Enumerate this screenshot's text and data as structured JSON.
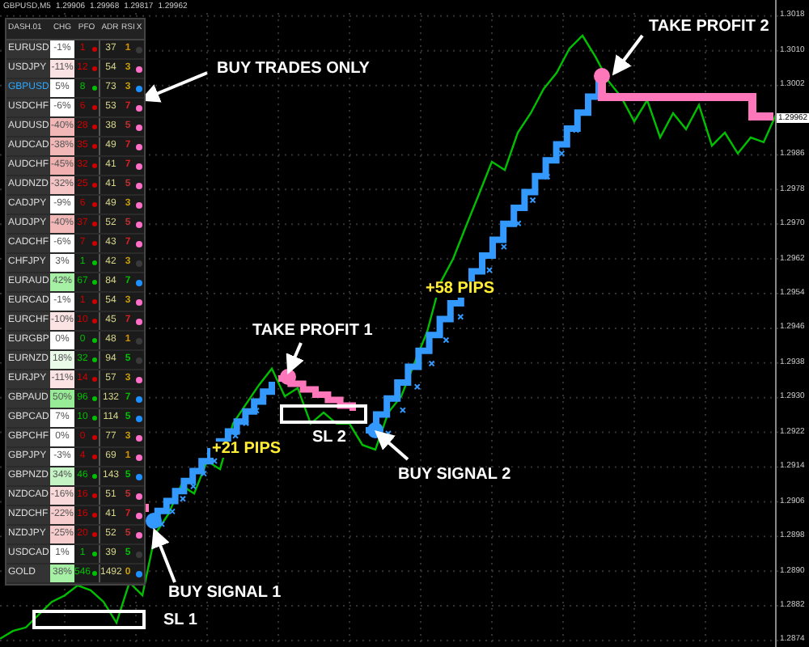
{
  "header": {
    "prices": [
      "1.29906",
      "1.29968",
      "1.29817",
      "1.29962"
    ]
  },
  "dashboard": {
    "columns": [
      "DASH.01",
      "CHG",
      "PFO",
      "ADR",
      "RSI",
      "X"
    ],
    "rows": [
      {
        "pair": "EURUSD",
        "selected": false,
        "chg": {
          "text": "-1%",
          "color": "#ffffff"
        },
        "pfo": {
          "text": "1",
          "color": "#d00000"
        },
        "adr": "37",
        "rsi": {
          "text": "1",
          "color": "#d09000"
        },
        "signal": {
          "color": "#3a3a3a"
        }
      },
      {
        "pair": "USDJPY",
        "selected": false,
        "chg": {
          "text": "-11%",
          "color": "#fbe3e3"
        },
        "pfo": {
          "text": "12",
          "color": "#d00000"
        },
        "adr": "54",
        "rsi": {
          "text": "3",
          "color": "#c8a000"
        },
        "signal": {
          "color": "#ff6ec7"
        }
      },
      {
        "pair": "GBPUSD",
        "selected": true,
        "chg": {
          "text": "5%",
          "color": "#ffffff"
        },
        "pfo": {
          "text": "8",
          "color": "#00c000"
        },
        "adr": "73",
        "rsi": {
          "text": "3",
          "color": "#c8a000"
        },
        "signal": {
          "color": "#1e90ff"
        }
      },
      {
        "pair": "USDCHF",
        "selected": false,
        "chg": {
          "text": "-6%",
          "color": "#ffffff"
        },
        "pfo": {
          "text": "6",
          "color": "#d00000"
        },
        "adr": "53",
        "rsi": {
          "text": "7",
          "color": "#e02020"
        },
        "signal": {
          "color": "#ff6ec7"
        }
      },
      {
        "pair": "AUDUSD",
        "selected": false,
        "chg": {
          "text": "-40%",
          "color": "#f2b8b8"
        },
        "pfo": {
          "text": "28",
          "color": "#d00000"
        },
        "adr": "38",
        "rsi": {
          "text": "5",
          "color": "#c03030"
        },
        "signal": {
          "color": "#ff6ec7"
        }
      },
      {
        "pair": "AUDCAD",
        "selected": false,
        "chg": {
          "text": "-38%",
          "color": "#f2b8b8"
        },
        "pfo": {
          "text": "35",
          "color": "#d00000"
        },
        "adr": "49",
        "rsi": {
          "text": "7",
          "color": "#e02020"
        },
        "signal": {
          "color": "#ff6ec7"
        }
      },
      {
        "pair": "AUDCHF",
        "selected": false,
        "chg": {
          "text": "-45%",
          "color": "#f0b0b0"
        },
        "pfo": {
          "text": "32",
          "color": "#d00000"
        },
        "adr": "41",
        "rsi": {
          "text": "7",
          "color": "#e02020"
        },
        "signal": {
          "color": "#ff6ec7"
        }
      },
      {
        "pair": "AUDNZD",
        "selected": false,
        "chg": {
          "text": "-32%",
          "color": "#f4c4c4"
        },
        "pfo": {
          "text": "25",
          "color": "#d00000"
        },
        "adr": "41",
        "rsi": {
          "text": "5",
          "color": "#c03030"
        },
        "signal": {
          "color": "#ff6ec7"
        }
      },
      {
        "pair": "CADJPY",
        "selected": false,
        "chg": {
          "text": "-9%",
          "color": "#ffffff"
        },
        "pfo": {
          "text": "6",
          "color": "#d00000"
        },
        "adr": "49",
        "rsi": {
          "text": "3",
          "color": "#c8a000"
        },
        "signal": {
          "color": "#ff6ec7"
        }
      },
      {
        "pair": "AUDJPY",
        "selected": false,
        "chg": {
          "text": "-40%",
          "color": "#f2b8b8"
        },
        "pfo": {
          "text": "37",
          "color": "#d00000"
        },
        "adr": "52",
        "rsi": {
          "text": "5",
          "color": "#c03030"
        },
        "signal": {
          "color": "#ff6ec7"
        }
      },
      {
        "pair": "CADCHF",
        "selected": false,
        "chg": {
          "text": "-6%",
          "color": "#ffffff"
        },
        "pfo": {
          "text": "7",
          "color": "#d00000"
        },
        "adr": "43",
        "rsi": {
          "text": "7",
          "color": "#e02020"
        },
        "signal": {
          "color": "#ff6ec7"
        }
      },
      {
        "pair": "CHFJPY",
        "selected": false,
        "chg": {
          "text": "3%",
          "color": "#ffffff"
        },
        "pfo": {
          "text": "1",
          "color": "#00c000"
        },
        "adr": "42",
        "rsi": {
          "text": "3",
          "color": "#c8a000"
        },
        "signal": {
          "color": "#3a3a3a"
        }
      },
      {
        "pair": "EURAUD",
        "selected": false,
        "chg": {
          "text": "42%",
          "color": "#a6f0a6"
        },
        "pfo": {
          "text": "67",
          "color": "#00c000"
        },
        "adr": "84",
        "rsi": {
          "text": "7",
          "color": "#00c000"
        },
        "signal": {
          "color": "#1e90ff"
        }
      },
      {
        "pair": "EURCAD",
        "selected": false,
        "chg": {
          "text": "-1%",
          "color": "#ffffff"
        },
        "pfo": {
          "text": "1",
          "color": "#d00000"
        },
        "adr": "54",
        "rsi": {
          "text": "3",
          "color": "#c8a000"
        },
        "signal": {
          "color": "#ff6ec7"
        }
      },
      {
        "pair": "EURCHF",
        "selected": false,
        "chg": {
          "text": "-10%",
          "color": "#fbe3e3"
        },
        "pfo": {
          "text": "10",
          "color": "#d00000"
        },
        "adr": "45",
        "rsi": {
          "text": "7",
          "color": "#e02020"
        },
        "signal": {
          "color": "#ff6ec7"
        }
      },
      {
        "pair": "EURGBP",
        "selected": false,
        "chg": {
          "text": "0%",
          "color": "#ffffff"
        },
        "pfo": {
          "text": "0",
          "color": "#00c000"
        },
        "adr": "48",
        "rsi": {
          "text": "1",
          "color": "#d09000"
        },
        "signal": {
          "color": "#3a3a3a"
        }
      },
      {
        "pair": "EURNZD",
        "selected": false,
        "chg": {
          "text": "18%",
          "color": "#eafbea"
        },
        "pfo": {
          "text": "32",
          "color": "#00c000"
        },
        "adr": "94",
        "rsi": {
          "text": "5",
          "color": "#00c000"
        },
        "signal": {
          "color": "#3a3a3a"
        }
      },
      {
        "pair": "EURJPY",
        "selected": false,
        "chg": {
          "text": "-11%",
          "color": "#fbe3e3"
        },
        "pfo": {
          "text": "14",
          "color": "#d00000"
        },
        "adr": "57",
        "rsi": {
          "text": "3",
          "color": "#c8a000"
        },
        "signal": {
          "color": "#ff6ec7"
        }
      },
      {
        "pair": "GBPAUD",
        "selected": false,
        "chg": {
          "text": "50%",
          "color": "#98ec98"
        },
        "pfo": {
          "text": "96",
          "color": "#00c000"
        },
        "adr": "132",
        "rsi": {
          "text": "7",
          "color": "#00c000"
        },
        "signal": {
          "color": "#1e90ff"
        }
      },
      {
        "pair": "GBPCAD",
        "selected": false,
        "chg": {
          "text": "7%",
          "color": "#ffffff"
        },
        "pfo": {
          "text": "10",
          "color": "#00c000"
        },
        "adr": "114",
        "rsi": {
          "text": "5",
          "color": "#00c000"
        },
        "signal": {
          "color": "#1e90ff"
        }
      },
      {
        "pair": "GBPCHF",
        "selected": false,
        "chg": {
          "text": "0%",
          "color": "#ffffff"
        },
        "pfo": {
          "text": "0",
          "color": "#d00000"
        },
        "adr": "77",
        "rsi": {
          "text": "3",
          "color": "#c8a000"
        },
        "signal": {
          "color": "#ff6ec7"
        }
      },
      {
        "pair": "GBPJPY",
        "selected": false,
        "chg": {
          "text": "-3%",
          "color": "#ffffff"
        },
        "pfo": {
          "text": "4",
          "color": "#d00000"
        },
        "adr": "69",
        "rsi": {
          "text": "1",
          "color": "#d09000"
        },
        "signal": {
          "color": "#ff6ec7"
        }
      },
      {
        "pair": "GBPNZD",
        "selected": false,
        "chg": {
          "text": "34%",
          "color": "#c4f4c4"
        },
        "pfo": {
          "text": "46",
          "color": "#00c000"
        },
        "adr": "143",
        "rsi": {
          "text": "5",
          "color": "#00c000"
        },
        "signal": {
          "color": "#1e90ff"
        }
      },
      {
        "pair": "NZDCAD",
        "selected": false,
        "chg": {
          "text": "-16%",
          "color": "#f9d9d9"
        },
        "pfo": {
          "text": "16",
          "color": "#d00000"
        },
        "adr": "51",
        "rsi": {
          "text": "5",
          "color": "#c03030"
        },
        "signal": {
          "color": "#ff6ec7"
        }
      },
      {
        "pair": "NZDCHF",
        "selected": false,
        "chg": {
          "text": "-22%",
          "color": "#f6cccc"
        },
        "pfo": {
          "text": "16",
          "color": "#d00000"
        },
        "adr": "41",
        "rsi": {
          "text": "7",
          "color": "#e02020"
        },
        "signal": {
          "color": "#ff6ec7"
        }
      },
      {
        "pair": "NZDJPY",
        "selected": false,
        "chg": {
          "text": "-25%",
          "color": "#f6cccc"
        },
        "pfo": {
          "text": "20",
          "color": "#d00000"
        },
        "adr": "52",
        "rsi": {
          "text": "5",
          "color": "#c03030"
        },
        "signal": {
          "color": "#ff6ec7"
        }
      },
      {
        "pair": "USDCAD",
        "selected": false,
        "chg": {
          "text": "1%",
          "color": "#ffffff"
        },
        "pfo": {
          "text": "1",
          "color": "#00c000"
        },
        "adr": "39",
        "rsi": {
          "text": "5",
          "color": "#00c000"
        },
        "signal": {
          "color": "#3a3a3a"
        }
      },
      {
        "pair": "GOLD",
        "selected": false,
        "chg": {
          "text": "38%",
          "color": "#a6f0a6"
        },
        "pfo": {
          "text": "546",
          "color": "#00c000"
        },
        "adr": "1492",
        "rsi": {
          "text": "0",
          "color": "#c8a000"
        },
        "signal": {
          "color": "#1e90ff"
        }
      }
    ]
  },
  "annotations": [
    {
      "kind": "label",
      "text": "BUY TRADES ONLY"
    },
    {
      "kind": "label",
      "text": "TAKE PROFIT 2"
    },
    {
      "kind": "label",
      "text": "TAKE PROFIT 1"
    },
    {
      "kind": "gain",
      "text": "+58 PIPS"
    },
    {
      "kind": "gain",
      "text": "+21 PIPS"
    },
    {
      "kind": "stop",
      "text": "SL 2"
    },
    {
      "kind": "label",
      "text": "BUY SIGNAL 2"
    },
    {
      "kind": "label",
      "text": "BUY SIGNAL 1"
    },
    {
      "kind": "stop",
      "text": "SL 1"
    }
  ],
  "price_axis": {
    "current": "1.29962"
  },
  "chart_data": {
    "type": "line",
    "grid": true,
    "ylim": [
      1.28725,
      1.30217
    ],
    "yticks": [
      {
        "value": 1.3018,
        "label": "1.3018"
      },
      {
        "value": 1.301,
        "label": "1.3010"
      },
      {
        "value": 1.3002,
        "label": "1.3002"
      },
      {
        "value": 1.2986,
        "label": "1.2986"
      },
      {
        "value": 1.2978,
        "label": "1.2978"
      },
      {
        "value": 1.297,
        "label": "1.2970"
      },
      {
        "value": 1.2962,
        "label": "1.2962"
      },
      {
        "value": 1.2954,
        "label": "1.2954"
      },
      {
        "value": 1.2946,
        "label": "1.2946"
      },
      {
        "value": 1.2938,
        "label": "1.2938"
      },
      {
        "value": 1.293,
        "label": "1.2930"
      },
      {
        "value": 1.2922,
        "label": "1.2922"
      },
      {
        "value": 1.2914,
        "label": "1.2914"
      },
      {
        "value": 1.2906,
        "label": "1.2906"
      },
      {
        "value": 1.2898,
        "label": "1.2898"
      },
      {
        "value": 1.289,
        "label": "1.2890"
      },
      {
        "value": 1.2882,
        "label": "1.2882"
      },
      {
        "value": 1.2874,
        "label": "1.2874"
      }
    ],
    "series": [
      {
        "name": "GBPUSD,M5",
        "color": "#00c000",
        "values": [
          1.28744,
          1.28762,
          1.2877,
          1.288,
          1.28829,
          1.28844,
          1.28867,
          1.28856,
          1.28829,
          1.28781,
          1.28874,
          1.28844,
          1.28986,
          1.29031,
          1.29098,
          1.29079,
          1.29154,
          1.29135,
          1.2924,
          1.29285,
          1.29329,
          1.29367,
          1.29303,
          1.29322,
          1.2924,
          1.29266,
          1.2924,
          1.2924,
          1.29191,
          1.2918,
          1.29266,
          1.29303,
          1.29378,
          1.29452,
          1.29564,
          1.2962,
          1.29695,
          1.29769,
          1.29844,
          1.29825,
          1.29911,
          1.29956,
          1.30012,
          1.30049,
          1.30105,
          1.30135,
          1.30086,
          1.3003,
          1.29993,
          1.29937,
          1.29986,
          1.299,
          1.29956,
          1.29919,
          1.29975,
          1.29881,
          1.29911,
          1.29863,
          1.299,
          1.29889,
          1.29956
        ]
      }
    ]
  }
}
